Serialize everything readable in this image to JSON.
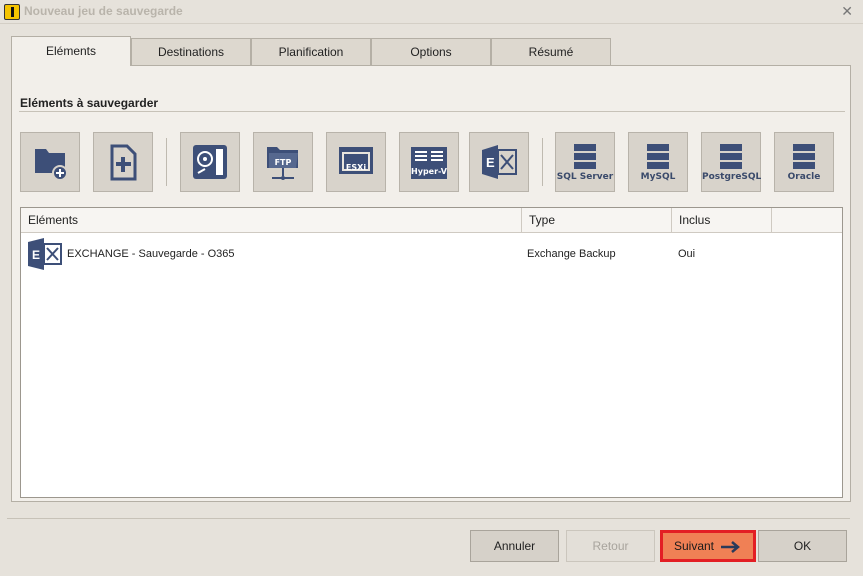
{
  "window": {
    "title": "Nouveau jeu de sauvegarde",
    "close_glyph": "✕"
  },
  "tabs": [
    {
      "label": "Eléments",
      "active": true
    },
    {
      "label": "Destinations",
      "active": false
    },
    {
      "label": "Planification",
      "active": false
    },
    {
      "label": "Options",
      "active": false
    },
    {
      "label": "Résumé",
      "active": false
    }
  ],
  "section": {
    "title": "Eléments à sauvegarder"
  },
  "toolbar": [
    {
      "icon": "folder-add-icon",
      "label": ""
    },
    {
      "icon": "file-add-icon",
      "label": ""
    },
    {
      "icon": "disk-image-icon",
      "label": ""
    },
    {
      "icon": "ftp-folder-icon",
      "label": "FTP"
    },
    {
      "icon": "esxi-icon",
      "label": "ESXi"
    },
    {
      "icon": "hyper-v-icon",
      "label": "Hyper-V"
    },
    {
      "icon": "exchange-icon",
      "label": ""
    },
    {
      "icon": "sql-server-icon",
      "label": "SQL Server"
    },
    {
      "icon": "mysql-icon",
      "label": "MySQL"
    },
    {
      "icon": "postgresql-icon",
      "label": "PostgreSQL"
    },
    {
      "icon": "oracle-icon",
      "label": "Oracle"
    }
  ],
  "table": {
    "columns": [
      "Eléments",
      "Type",
      "Inclus"
    ],
    "rows": [
      {
        "icon": "exchange-icon",
        "name": "EXCHANGE - Sauvegarde - O365",
        "type": "Exchange Backup",
        "included": "Oui"
      }
    ]
  },
  "buttons": {
    "cancel": "Annuler",
    "back": "Retour",
    "next": "Suivant",
    "ok": "OK"
  },
  "colors": {
    "icon_blue": "#3d4f78",
    "next_button": "#f08055",
    "highlight_border": "#e31e24"
  }
}
